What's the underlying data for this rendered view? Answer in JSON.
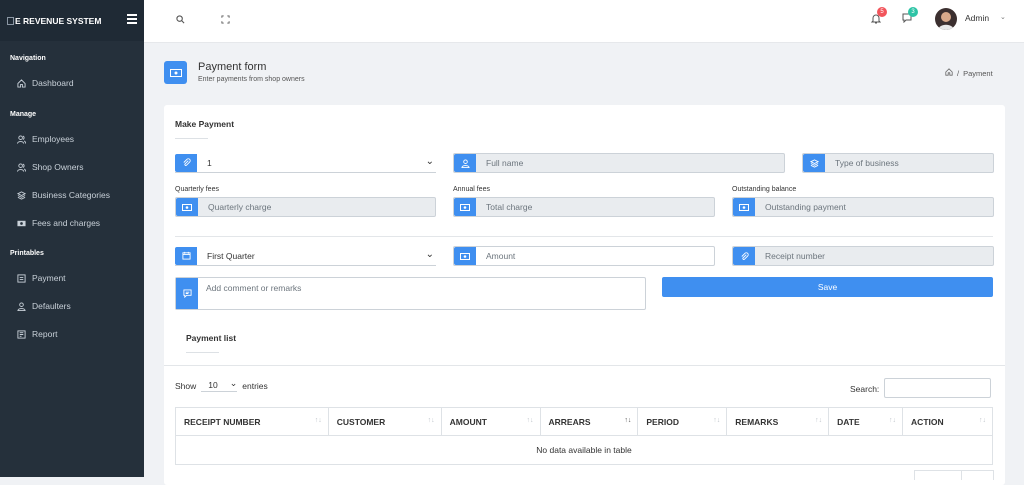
{
  "brand": {
    "name": "E REVENUE SYSTEM"
  },
  "sidebar": {
    "sections": [
      {
        "label": "Navigation"
      },
      {
        "label": "Manage"
      },
      {
        "label": "Printables"
      }
    ],
    "items": [
      {
        "label": "Dashboard",
        "icon": "home-icon"
      },
      {
        "label": "Employees",
        "icon": "users-icon"
      },
      {
        "label": "Shop Owners",
        "icon": "users-icon"
      },
      {
        "label": "Business Categories",
        "icon": "layers-icon"
      },
      {
        "label": "Fees and charges",
        "icon": "money-icon"
      },
      {
        "label": "Payment",
        "icon": "receipt-icon"
      },
      {
        "label": "Defaulters",
        "icon": "user-icon"
      },
      {
        "label": "Report",
        "icon": "report-icon"
      }
    ]
  },
  "topbar": {
    "notif_count": "5",
    "msg_count": "3",
    "user": "Admin"
  },
  "page": {
    "title": "Payment form",
    "subtitle": "Enter payments from shop owners",
    "crumb_sep": "/",
    "crumb": "Payment"
  },
  "form": {
    "heading": "Make Payment",
    "owner_value": "1",
    "fullname_ph": "Full name",
    "business_ph": "Type of business",
    "quarterly_label": "Quarterly fees",
    "quarterly_ph": "Quarterly charge",
    "annual_label": "Annual fees",
    "annual_ph": "Total charge",
    "outstanding_label": "Outstanding balance",
    "outstanding_ph": "Outstanding payment",
    "period_value": "First Quarter",
    "amount_ph": "Amount",
    "receipt_ph": "Receipt number",
    "remarks_ph": "Add comment or remarks",
    "save_label": "Save"
  },
  "list": {
    "heading": "Payment list",
    "show_label": "Show",
    "entries_value": "10",
    "entries_label": "entries",
    "search_label": "Search:",
    "columns": [
      "RECEIPT NUMBER",
      "CUSTOMER",
      "AMOUNT",
      "ARREARS",
      "PERIOD",
      "REMARKS",
      "DATE",
      "ACTION"
    ],
    "empty": "No data available in table"
  },
  "colors": {
    "accent": "#3f8ff0",
    "sidebar": "#25303b",
    "notif": "#f2545b",
    "msg": "#2ec4a6"
  }
}
